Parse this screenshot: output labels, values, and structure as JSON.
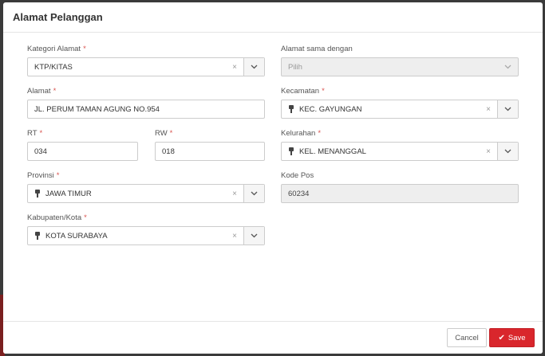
{
  "modal": {
    "title": "Alamat Pelanggan"
  },
  "form": {
    "kategori_alamat": {
      "label": "Kategori Alamat",
      "required": "*",
      "value": "KTP/KITAS",
      "clear": "×"
    },
    "alamat_sama_dengan": {
      "label": "Alamat sama dengan",
      "value": "Pilih"
    },
    "alamat": {
      "label": "Alamat",
      "required": "*",
      "value": "JL. PERUM TAMAN AGUNG NO.954"
    },
    "kecamatan": {
      "label": "Kecamatan",
      "required": "*",
      "value": "KEC. GAYUNGAN",
      "clear": "×"
    },
    "rt": {
      "label": "RT",
      "required": "*",
      "value": "034"
    },
    "rw": {
      "label": "RW",
      "required": "*",
      "value": "018"
    },
    "kelurahan": {
      "label": "Kelurahan",
      "required": "*",
      "value": "KEL. MENANGGAL",
      "clear": "×"
    },
    "provinsi": {
      "label": "Provinsi",
      "required": "*",
      "value": "JAWA TIMUR",
      "clear": "×"
    },
    "kode_pos": {
      "label": "Kode Pos",
      "value": "60234"
    },
    "kabupaten_kota": {
      "label": "Kabupaten/Kota",
      "required": "*",
      "value": "KOTA SURABAYA",
      "clear": "×"
    }
  },
  "footer": {
    "cancel_label": "Cancel",
    "save_label": "Save",
    "save_icon": "check-icon"
  },
  "colors": {
    "primary": "#d9262c",
    "required": "#d9534f",
    "disabled_bg": "#eeeeee"
  }
}
